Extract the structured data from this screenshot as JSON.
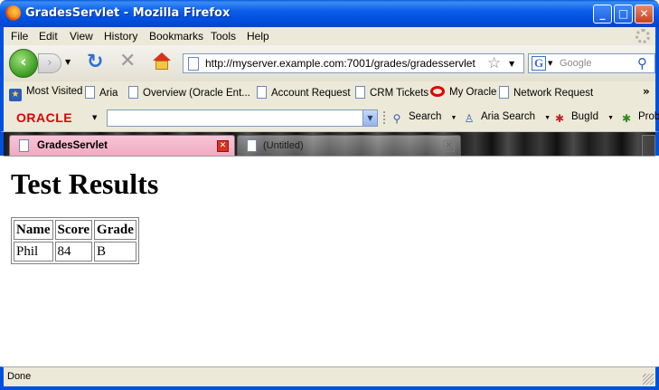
{
  "window": {
    "title": "GradesServlet - Mozilla Firefox"
  },
  "menu": {
    "items": [
      "File",
      "Edit",
      "View",
      "History",
      "Bookmarks",
      "Tools",
      "Help"
    ]
  },
  "nav": {
    "url": "http://myserver.example.com:7001/grades/gradesservlet",
    "search_placeholder": "Google"
  },
  "bookmarks": {
    "items": [
      "Most Visited",
      "Aria",
      "Overview (Oracle Ent...",
      "Account Request",
      "CRM Tickets",
      "My Oracle",
      "Network Request"
    ]
  },
  "oracle_toolbar": {
    "logo": "ORACLE",
    "search_label": "Search",
    "aria_search_label": "Aria Search",
    "bugid_label": "BugId",
    "prob_label": "Prob"
  },
  "tabs": [
    {
      "label": "GradesServlet",
      "active": true
    },
    {
      "label": "(Untitled)",
      "active": false
    }
  ],
  "page": {
    "heading": "Test Results",
    "table": {
      "headers": [
        "Name",
        "Score",
        "Grade"
      ],
      "rows": [
        [
          "Phil",
          "84",
          "B"
        ]
      ]
    }
  },
  "status": {
    "text": "Done"
  },
  "colors": {
    "titlebar": "#0050e0",
    "oracle_red": "#e00000",
    "active_tab": "#f2a9c2"
  }
}
